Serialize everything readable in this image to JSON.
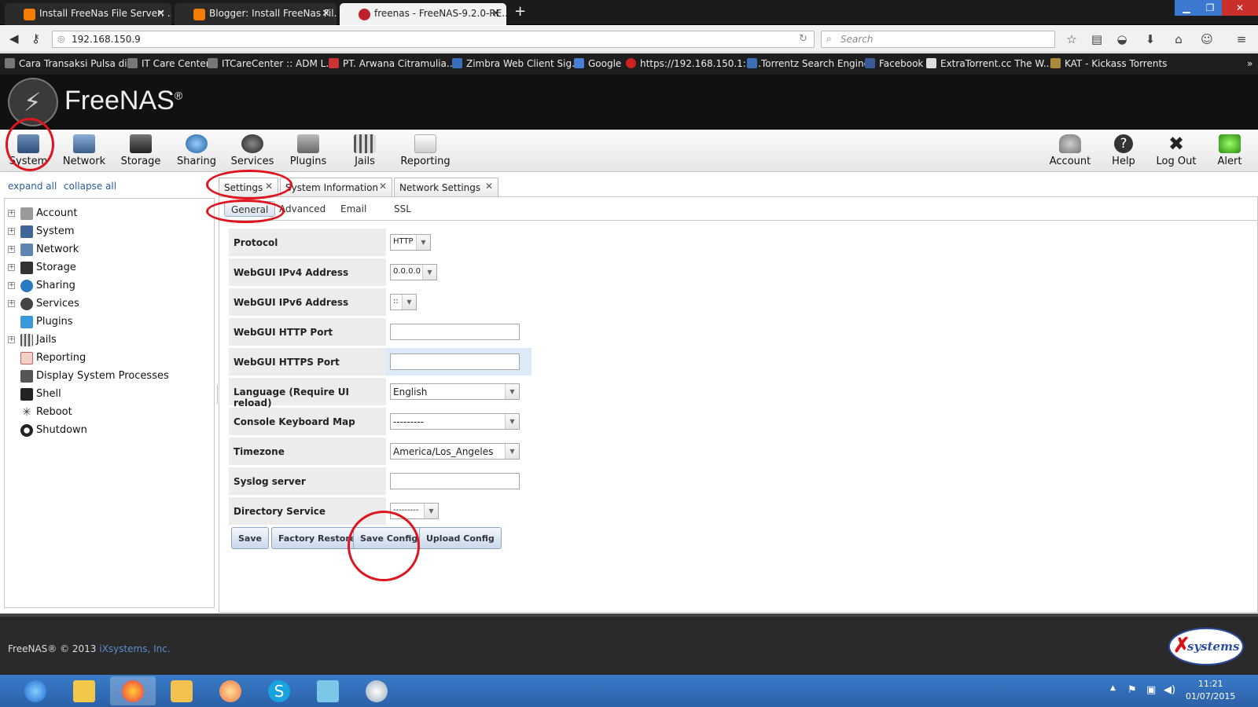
{
  "browser": {
    "tabs": [
      {
        "label": "Install FreeNas File Server: ...",
        "active": false
      },
      {
        "label": "Blogger: Install FreeNas Fil...",
        "active": false
      },
      {
        "label": "freenas - FreeNAS-9.2.0-RE...",
        "active": true
      }
    ],
    "url": "192.168.150.9",
    "search_placeholder": "Search",
    "bookmarks": [
      "Cara Transaksi Pulsa di...",
      "IT Care Center",
      "ITCareCenter :: ADM L...",
      "PT. Arwana Citramulia...",
      "Zimbra Web Client Sig...",
      "Google",
      "https://192.168.150.1:3...",
      "Torrentz Search Engine",
      "Facebook",
      "ExtraTorrent.cc The W...",
      "KAT - Kickass Torrents"
    ],
    "overflow": "»"
  },
  "app": {
    "name": "FreeNAS",
    "reg": "®"
  },
  "toolbar": {
    "left": [
      "System",
      "Network",
      "Storage",
      "Sharing",
      "Services",
      "Plugins",
      "Jails",
      "Reporting"
    ],
    "right": [
      "Account",
      "Help",
      "Log Out",
      "Alert"
    ]
  },
  "tree": {
    "expand_all": "expand all",
    "collapse_all": "collapse all",
    "items": [
      {
        "label": "Account",
        "expandable": true
      },
      {
        "label": "System",
        "expandable": true
      },
      {
        "label": "Network",
        "expandable": true
      },
      {
        "label": "Storage",
        "expandable": true
      },
      {
        "label": "Sharing",
        "expandable": true
      },
      {
        "label": "Services",
        "expandable": true
      },
      {
        "label": "Plugins",
        "expandable": false
      },
      {
        "label": "Jails",
        "expandable": true
      },
      {
        "label": "Reporting",
        "expandable": false
      },
      {
        "label": "Display System Processes",
        "expandable": false
      },
      {
        "label": "Shell",
        "expandable": false
      },
      {
        "label": "Reboot",
        "expandable": false
      },
      {
        "label": "Shutdown",
        "expandable": false
      }
    ]
  },
  "main_tabs": [
    "Settings",
    "System Information",
    "Network Settings"
  ],
  "sub_tabs": [
    "General",
    "Advanced",
    "Email",
    "SSL"
  ],
  "form": {
    "fields": [
      {
        "label": "Protocol",
        "type": "select",
        "value": "HTTP"
      },
      {
        "label": "WebGUI IPv4 Address",
        "type": "select",
        "value": "0.0.0.0"
      },
      {
        "label": "WebGUI IPv6 Address",
        "type": "select",
        "value": "::"
      },
      {
        "label": "WebGUI HTTP Port",
        "type": "text",
        "value": ""
      },
      {
        "label": "WebGUI HTTPS Port",
        "type": "text",
        "value": ""
      },
      {
        "label": "Language (Require UI reload)",
        "type": "select",
        "value": "English"
      },
      {
        "label": "Console Keyboard Map",
        "type": "select",
        "value": "---------"
      },
      {
        "label": "Timezone",
        "type": "select",
        "value": "America/Los_Angeles"
      },
      {
        "label": "Syslog server",
        "type": "text",
        "value": ""
      },
      {
        "label": "Directory Service",
        "type": "select",
        "value": "---------"
      }
    ],
    "buttons": [
      "Save",
      "Factory Restore",
      "Save Config",
      "Upload Config"
    ]
  },
  "footer": {
    "copyright": "FreeNAS® © 2013",
    "company": "iXsystems, Inc.",
    "logo_text": "systems"
  },
  "taskbar": {
    "time": "11:21",
    "date": "01/07/2015"
  },
  "colors": {
    "accent_ring": "#e0141e",
    "header_bg": "#111111",
    "taskbar": "#2b61a8"
  }
}
